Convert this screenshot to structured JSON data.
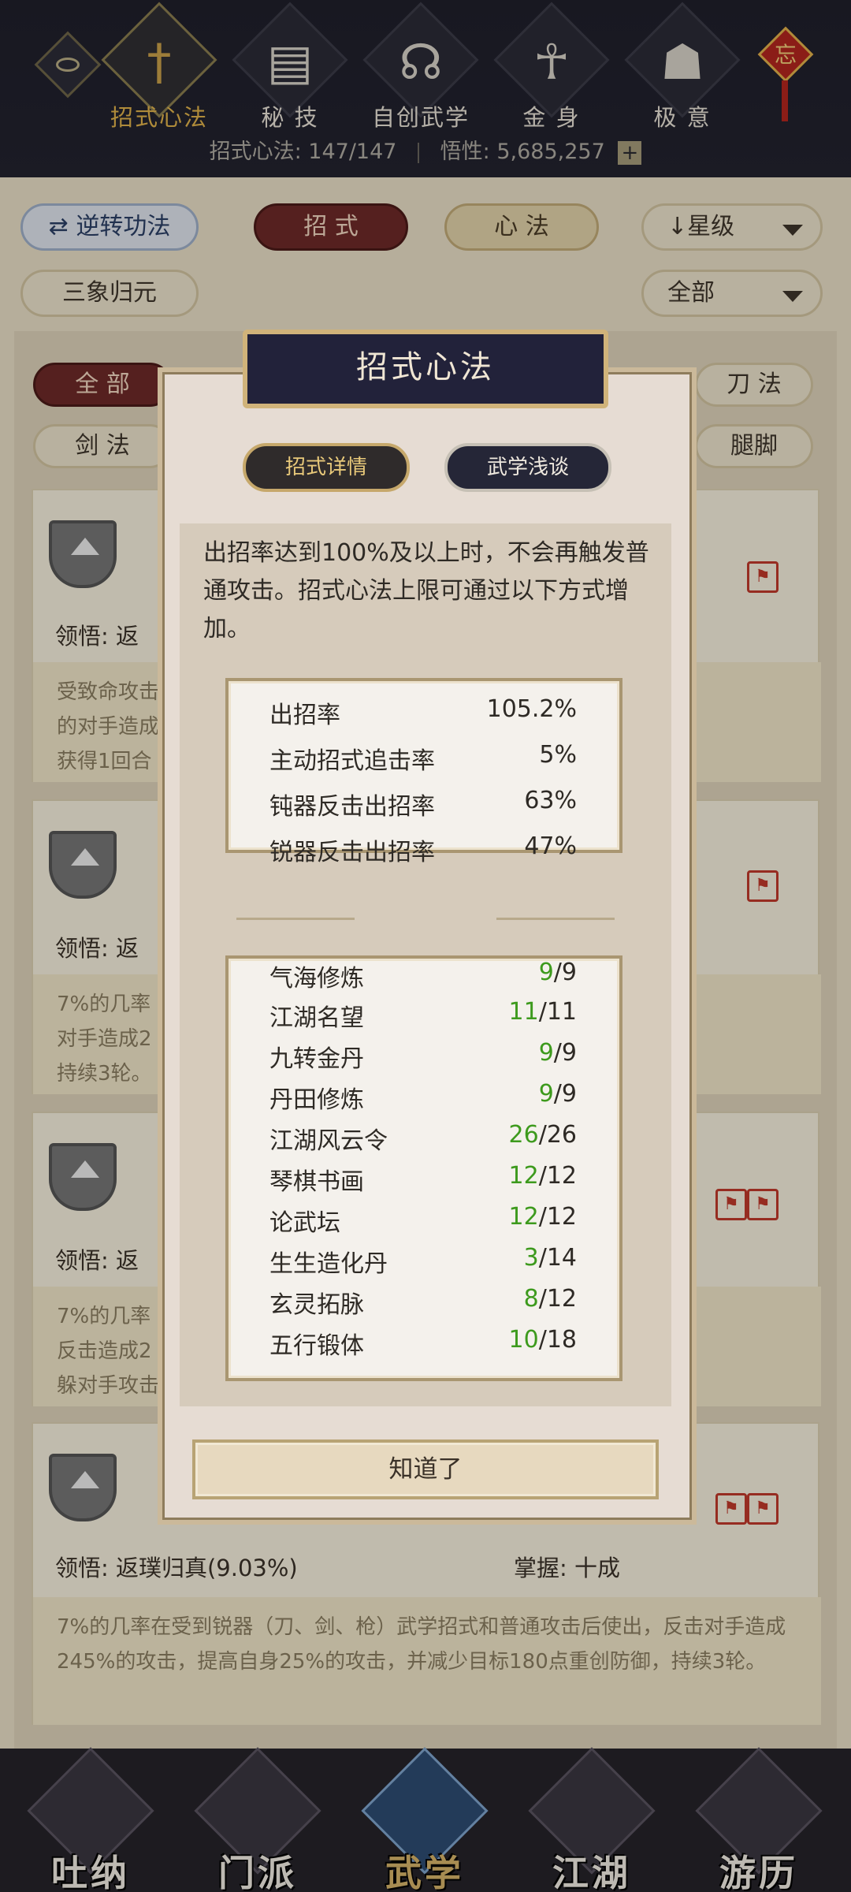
{
  "top_nav": {
    "tabs": [
      {
        "label": "招式心法",
        "icon": "sword-icon",
        "glyph": "†"
      },
      {
        "label": "秘 技",
        "icon": "book-icon",
        "glyph": "▤"
      },
      {
        "label": "自创武学",
        "icon": "scroll-icon",
        "glyph": "☊"
      },
      {
        "label": "金 身",
        "icon": "meditation-icon",
        "glyph": "☥"
      },
      {
        "label": "极 意",
        "icon": "martial-pose-icon",
        "glyph": "☗"
      }
    ],
    "knot_char": "忘",
    "stats": {
      "skills": "招式心法: 147/147",
      "insight": "悟性: 5,685,257",
      "plus": "+"
    }
  },
  "filters": {
    "reverse": "⇄ 逆转功法",
    "zhaoshi": "招 式",
    "xinfa": "心 法",
    "sort": "↓星级",
    "sanxiang": "三象归元",
    "all_select": "全部",
    "quanbu": "全 部",
    "daofa": "刀 法",
    "jianfa": "剑 法",
    "tuijiao": "腿脚"
  },
  "cards": [
    {
      "lingwu": "领悟: 返",
      "desc": "受致命攻击                                    伤附近\n的对手造成                                    击，你将\n获得1回合"
    },
    {
      "lingwu": "领悟: 返",
      "desc": "7%的几率                                    ，反击\n对手造成2                                    创防御，\n持续3轮。"
    },
    {
      "lingwu": "领悟: 返",
      "desc": "7%的几率                                    使出，\n反击造成2                                    几率闪\n躲对手攻击"
    },
    {
      "lingwu": "领悟: 返璞归真(9.03%)",
      "zhangwo": "掌握: 十成",
      "desc": "7%的几率在受到锐器（刀、剑、枪）武学招式和普通攻击后使出，反击对手造成245%的攻击，提高自身25%的攻击，并减少目标180点重创防御，持续3轮。"
    }
  ],
  "bottom_nav": [
    "吐纳",
    "门派",
    "武学",
    "江湖",
    "游历"
  ],
  "modal": {
    "title": "招式心法",
    "tabs": {
      "detail": "招式详情",
      "talk": "武学浅谈"
    },
    "intro": "出招率达到100%及以上时，不会再触发普通攻击。招式心法上限可通过以下方式增加。",
    "rates": [
      {
        "name": "出招率",
        "value": "105.2%"
      },
      {
        "name": "主动招式追击率",
        "value": "5%"
      },
      {
        "name": "钝器反击出招率",
        "value": "63%"
      },
      {
        "name": "锐器反击出招率",
        "value": "47%"
      }
    ],
    "sources": [
      {
        "name": "气海修炼",
        "cur": "9",
        "max": "/9"
      },
      {
        "name": "江湖名望",
        "cur": "11",
        "max": "/11"
      },
      {
        "name": "九转金丹",
        "cur": "9",
        "max": "/9"
      },
      {
        "name": "丹田修炼",
        "cur": "9",
        "max": "/9"
      },
      {
        "name": "江湖风云令",
        "cur": "26",
        "max": "/26"
      },
      {
        "name": "琴棋书画",
        "cur": "12",
        "max": "/12"
      },
      {
        "name": "论武坛",
        "cur": "12",
        "max": "/12"
      },
      {
        "name": "生生造化丹",
        "cur": "3",
        "max": "/14"
      },
      {
        "name": "玄灵拓脉",
        "cur": "8",
        "max": "/12"
      },
      {
        "name": "五行锻体",
        "cur": "10",
        "max": "/18"
      }
    ],
    "ok": "知道了"
  },
  "colors": {
    "accent_gold": "#e0b34b",
    "progress_green": "#3d9a1d",
    "modal_title_bg": "#22223a"
  }
}
